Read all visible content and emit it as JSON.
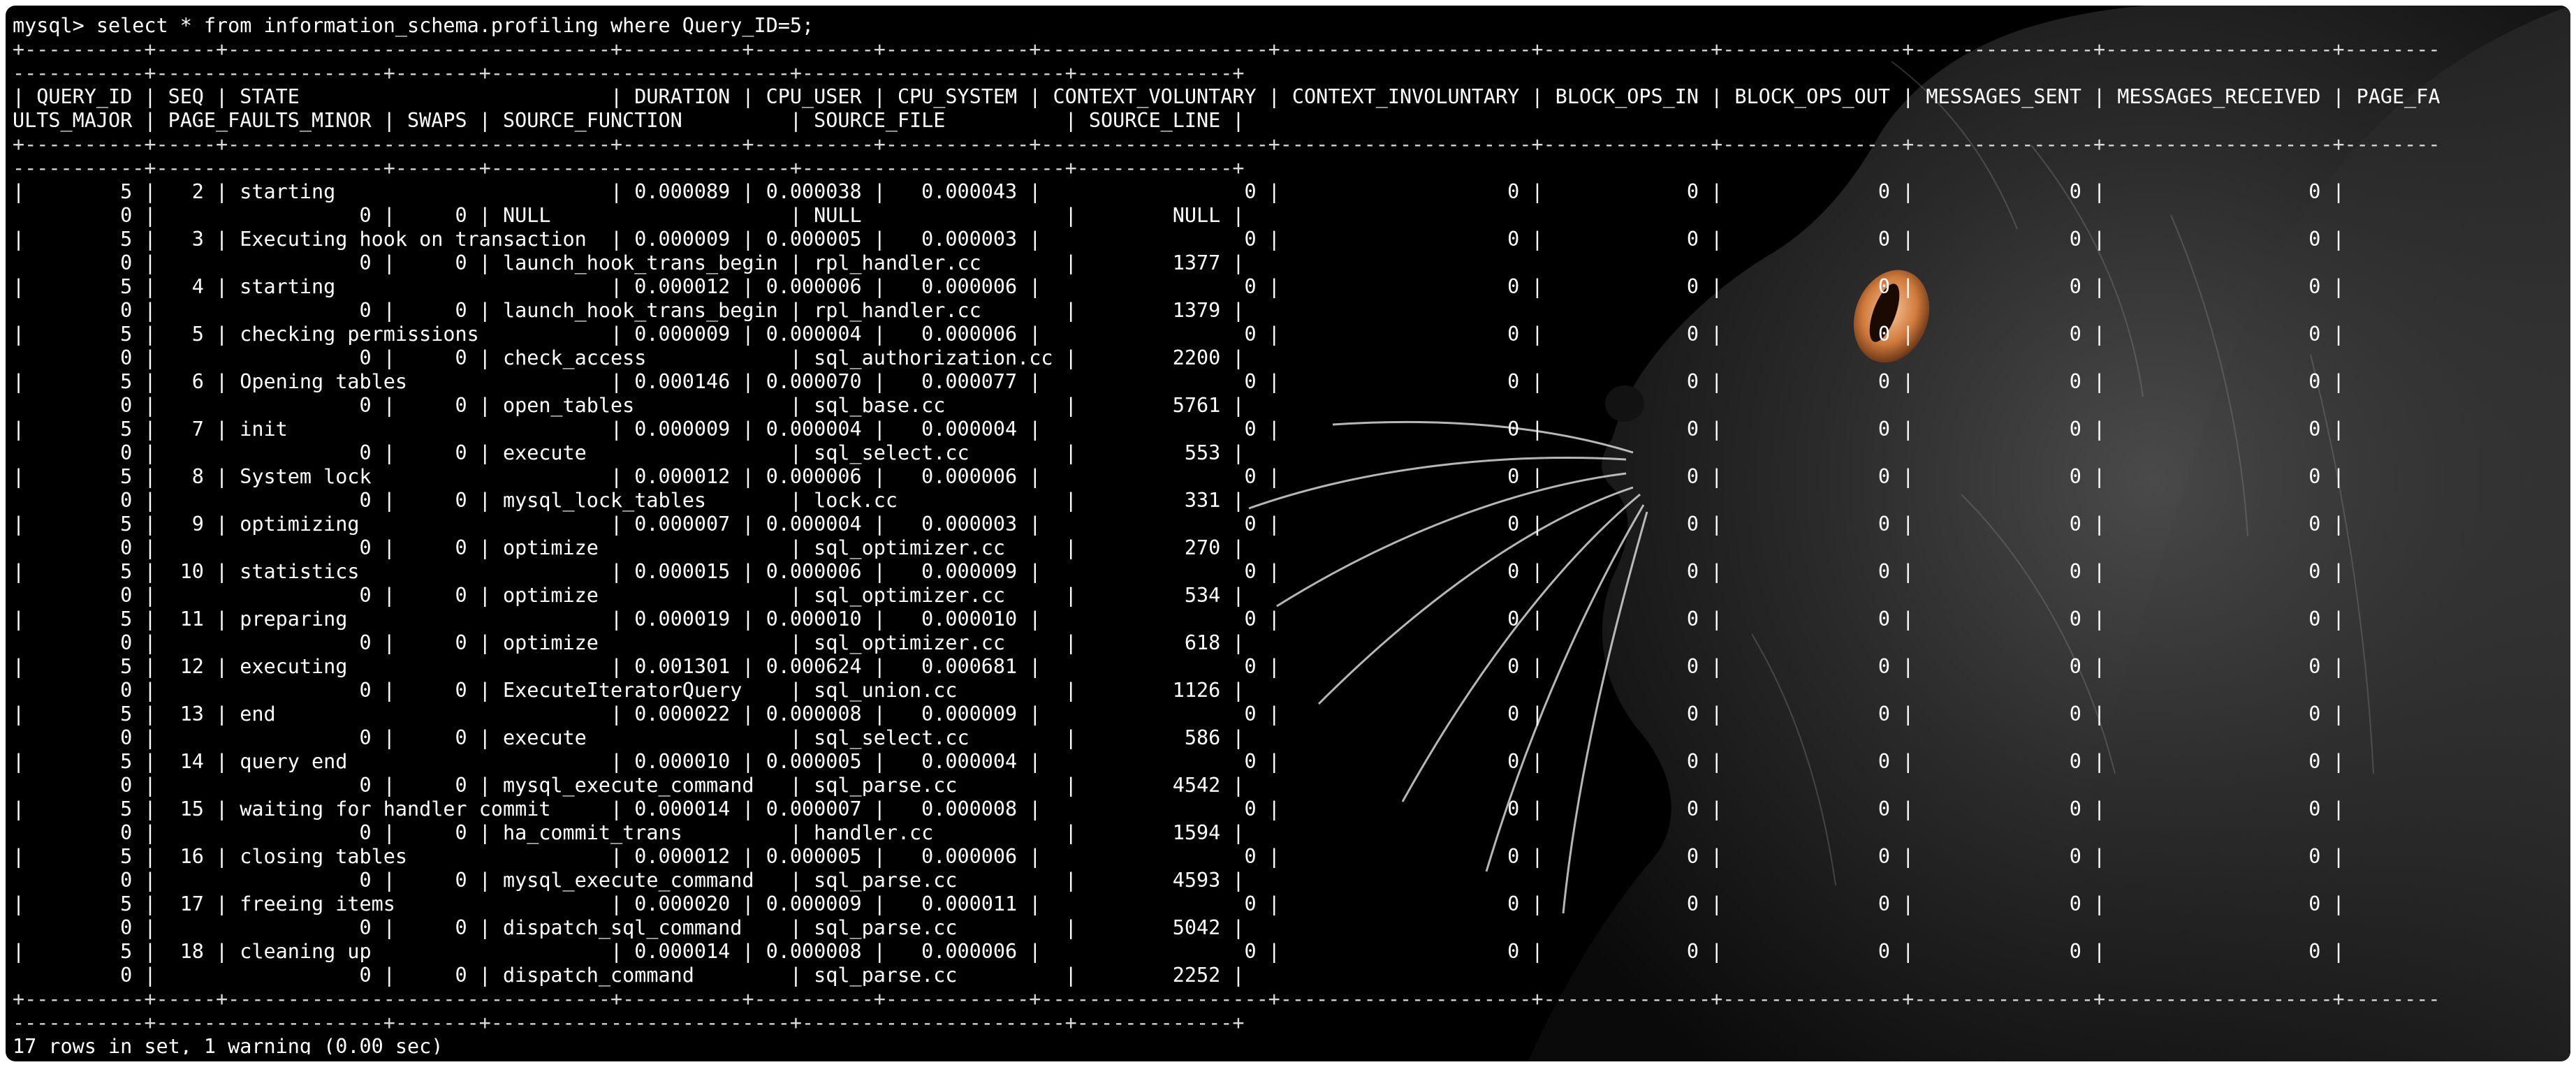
{
  "terminal": {
    "command": "mysql> select * from information_schema.profiling where Query_ID=5;",
    "separator": "+----------+-----+--------------------------------+----------+----------+------------+-------------------+---------------------+--------------+---------------+---------------+-------------------+-------------------+-------------------+-------+-------------------------+----------------------+-------------+",
    "columns": [
      "QUERY_ID",
      "SEQ",
      "STATE",
      "DURATION",
      "CPU_USER",
      "CPU_SYSTEM",
      "CONTEXT_VOLUNTARY",
      "CONTEXT_INVOLUNTARY",
      "BLOCK_OPS_IN",
      "BLOCK_OPS_OUT",
      "MESSAGES_SENT",
      "MESSAGES_RECEIVED",
      "PAGE_FAULTS_MAJOR",
      "PAGE_FAULTS_MINOR",
      "SWAPS",
      "SOURCE_FUNCTION",
      "SOURCE_FILE",
      "SOURCE_LINE"
    ],
    "rows": [
      [
        "5",
        "2",
        "starting",
        "0.000089",
        "0.000038",
        "0.000043",
        "0",
        "0",
        "0",
        "0",
        "0",
        "0",
        "0",
        "0",
        "0",
        "NULL",
        "NULL",
        "NULL"
      ],
      [
        "5",
        "3",
        "Executing hook on transaction",
        "0.000009",
        "0.000005",
        "0.000003",
        "0",
        "0",
        "0",
        "0",
        "0",
        "0",
        "0",
        "0",
        "0",
        "launch_hook_trans_begin",
        "rpl_handler.cc",
        "1377"
      ],
      [
        "5",
        "4",
        "starting",
        "0.000012",
        "0.000006",
        "0.000006",
        "0",
        "0",
        "0",
        "0",
        "0",
        "0",
        "0",
        "0",
        "0",
        "launch_hook_trans_begin",
        "rpl_handler.cc",
        "1379"
      ],
      [
        "5",
        "5",
        "checking permissions",
        "0.000009",
        "0.000004",
        "0.000006",
        "0",
        "0",
        "0",
        "0",
        "0",
        "0",
        "0",
        "0",
        "0",
        "check_access",
        "sql_authorization.cc",
        "2200"
      ],
      [
        "5",
        "6",
        "Opening tables",
        "0.000146",
        "0.000070",
        "0.000077",
        "0",
        "0",
        "0",
        "0",
        "0",
        "0",
        "0",
        "0",
        "0",
        "open_tables",
        "sql_base.cc",
        "5761"
      ],
      [
        "5",
        "7",
        "init",
        "0.000009",
        "0.000004",
        "0.000004",
        "0",
        "0",
        "0",
        "0",
        "0",
        "0",
        "0",
        "0",
        "0",
        "execute",
        "sql_select.cc",
        "553"
      ],
      [
        "5",
        "8",
        "System lock",
        "0.000012",
        "0.000006",
        "0.000006",
        "0",
        "0",
        "0",
        "0",
        "0",
        "0",
        "0",
        "0",
        "0",
        "mysql_lock_tables",
        "lock.cc",
        "331"
      ],
      [
        "5",
        "9",
        "optimizing",
        "0.000007",
        "0.000004",
        "0.000003",
        "0",
        "0",
        "0",
        "0",
        "0",
        "0",
        "0",
        "0",
        "0",
        "optimize",
        "sql_optimizer.cc",
        "270"
      ],
      [
        "5",
        "10",
        "statistics",
        "0.000015",
        "0.000006",
        "0.000009",
        "0",
        "0",
        "0",
        "0",
        "0",
        "0",
        "0",
        "0",
        "0",
        "optimize",
        "sql_optimizer.cc",
        "534"
      ],
      [
        "5",
        "11",
        "preparing",
        "0.000019",
        "0.000010",
        "0.000010",
        "0",
        "0",
        "0",
        "0",
        "0",
        "0",
        "0",
        "0",
        "0",
        "optimize",
        "sql_optimizer.cc",
        "618"
      ],
      [
        "5",
        "12",
        "executing",
        "0.001301",
        "0.000624",
        "0.000681",
        "0",
        "0",
        "0",
        "0",
        "0",
        "0",
        "0",
        "0",
        "0",
        "ExecuteIteratorQuery",
        "sql_union.cc",
        "1126"
      ],
      [
        "5",
        "13",
        "end",
        "0.000022",
        "0.000008",
        "0.000009",
        "0",
        "0",
        "0",
        "0",
        "0",
        "0",
        "0",
        "0",
        "0",
        "execute",
        "sql_select.cc",
        "586"
      ],
      [
        "5",
        "14",
        "query end",
        "0.000010",
        "0.000005",
        "0.000004",
        "0",
        "0",
        "0",
        "0",
        "0",
        "0",
        "0",
        "0",
        "0",
        "mysql_execute_command",
        "sql_parse.cc",
        "4542"
      ],
      [
        "5",
        "15",
        "waiting for handler commit",
        "0.000014",
        "0.000007",
        "0.000008",
        "0",
        "0",
        "0",
        "0",
        "0",
        "0",
        "0",
        "0",
        "0",
        "ha_commit_trans",
        "handler.cc",
        "1594"
      ],
      [
        "5",
        "16",
        "closing tables",
        "0.000012",
        "0.000005",
        "0.000006",
        "0",
        "0",
        "0",
        "0",
        "0",
        "0",
        "0",
        "0",
        "0",
        "mysql_execute_command",
        "sql_parse.cc",
        "4593"
      ],
      [
        "5",
        "17",
        "freeing items",
        "0.000020",
        "0.000009",
        "0.000011",
        "0",
        "0",
        "0",
        "0",
        "0",
        "0",
        "0",
        "0",
        "0",
        "dispatch_sql_command",
        "sql_parse.cc",
        "5042"
      ],
      [
        "5",
        "18",
        "cleaning up",
        "0.000014",
        "0.000008",
        "0.000006",
        "0",
        "0",
        "0",
        "0",
        "0",
        "0",
        "0",
        "0",
        "0",
        "dispatch_command",
        "sql_parse.cc",
        "2252"
      ]
    ],
    "footer": "17 rows in set, 1 warning (0.00 sec)"
  },
  "background": {
    "window_color": "#000000",
    "text_color": "#ffffff",
    "eye_color": "#e0925a"
  }
}
